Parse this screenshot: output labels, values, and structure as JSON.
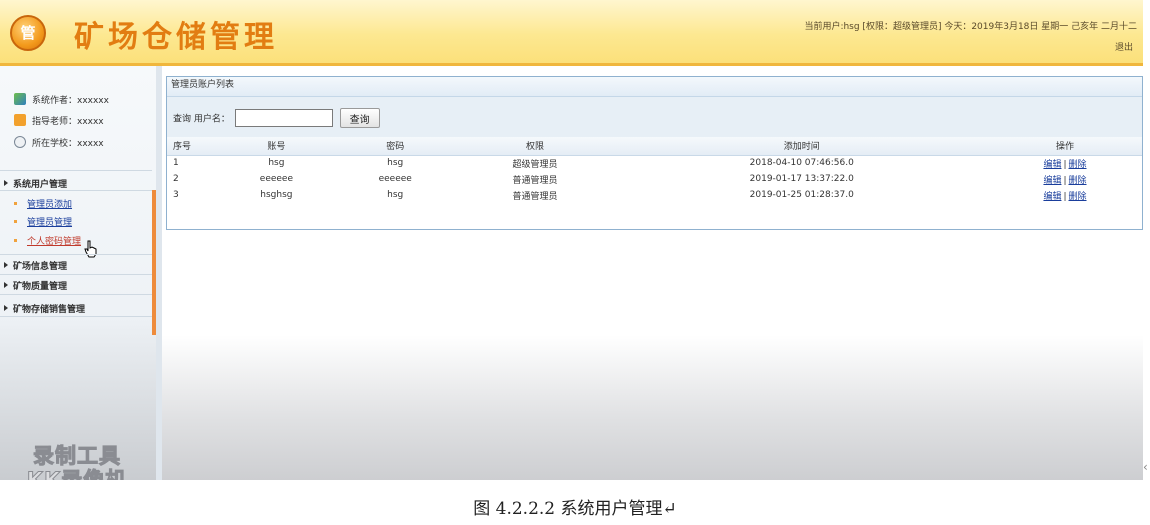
{
  "header": {
    "logo_text": "管",
    "title": "矿场仓储管理",
    "user_info": "当前用户:hsg [权限：超级管理员] 今天：2019年3月18日 星期一 己亥年 二月十二",
    "logout": "退出"
  },
  "sidebar": {
    "info": [
      {
        "label": "系统作者：xxxxxx"
      },
      {
        "label": "指导老师：xxxxx"
      },
      {
        "label": "所在学校：xxxxx"
      }
    ],
    "menus": [
      {
        "title": "系统用户管理",
        "items": [
          "管理员添加",
          "管理员管理",
          "个人密码管理"
        ]
      },
      {
        "title": "矿场信息管理"
      },
      {
        "title": "矿物质量管理"
      },
      {
        "title": "矿物存储销售管理"
      }
    ],
    "watermark_line1": "录制工具",
    "watermark_line2": "KK录像机"
  },
  "panel": {
    "title": "管理员账户列表",
    "search_label": "查询 用户名：",
    "search_value": "",
    "search_button": "查询",
    "columns": [
      "序号",
      "账号",
      "密码",
      "权限",
      "添加时间",
      "操作"
    ],
    "rows": [
      {
        "no": "1",
        "account": "hsg",
        "password": "hsg",
        "role": "超级管理员",
        "time": "2018-04-10 07:46:56.0"
      },
      {
        "no": "2",
        "account": "eeeeee",
        "password": "eeeeee",
        "role": "普通管理员",
        "time": "2019-01-17 13:37:22.0"
      },
      {
        "no": "3",
        "account": "hsghsg",
        "password": "hsg",
        "role": "普通管理员",
        "time": "2019-01-25 01:28:37.0"
      }
    ],
    "edit_label": "编辑",
    "op_separator": "|",
    "delete_label": "删除"
  },
  "caption": "图 4.2.2.2 系统用户管理↵",
  "page_mark": "‹",
  "colors": {
    "accent": "#e27d12",
    "header_border": "#f0b63c",
    "link": "#1a3e9c",
    "panel_border": "#8fb1cf"
  }
}
